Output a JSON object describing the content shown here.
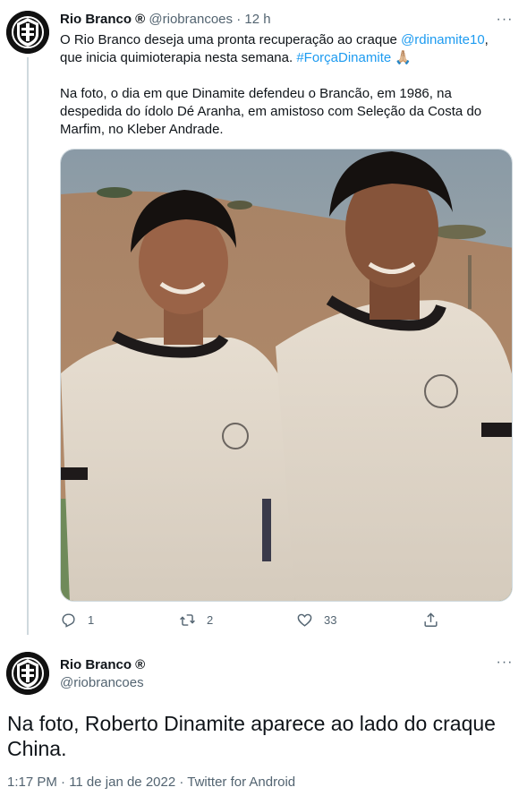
{
  "tweet1": {
    "author_name": "Rio Branco ®",
    "handle": "@riobrancoes",
    "separator": "·",
    "time": "12 h",
    "more_label": "···",
    "text_before_mention": "O Rio Branco deseja uma pronta recuperação ao craque ",
    "mention": "@rdinamite10",
    "text_after_mention": ", que inicia quimioterapia nesta semana. ",
    "hashtag": "#ForçaDinamite",
    "emoji": "🙏🏼",
    "paragraph2": "Na foto, o dia em que Dinamite defendeu o Brancão, em 1986, na despedida do ídolo Dé Aranha, em amistoso com Seleção da Costa do Marfim, no Kleber Andrade.",
    "actions": {
      "reply_count": "1",
      "retweet_count": "2",
      "like_count": "33"
    }
  },
  "tweet2": {
    "author_name": "Rio Branco ®",
    "handle": "@riobrancoes",
    "more_label": "···",
    "text": "Na foto, Roberto Dinamite aparece ao lado do craque China.",
    "meta": "1:17 PM · 11 de jan de 2022 · Twitter for Android"
  },
  "colors": {
    "link": "#1d9bf0",
    "muted": "#536471",
    "text": "#0f1419",
    "border": "#cfd9de"
  }
}
